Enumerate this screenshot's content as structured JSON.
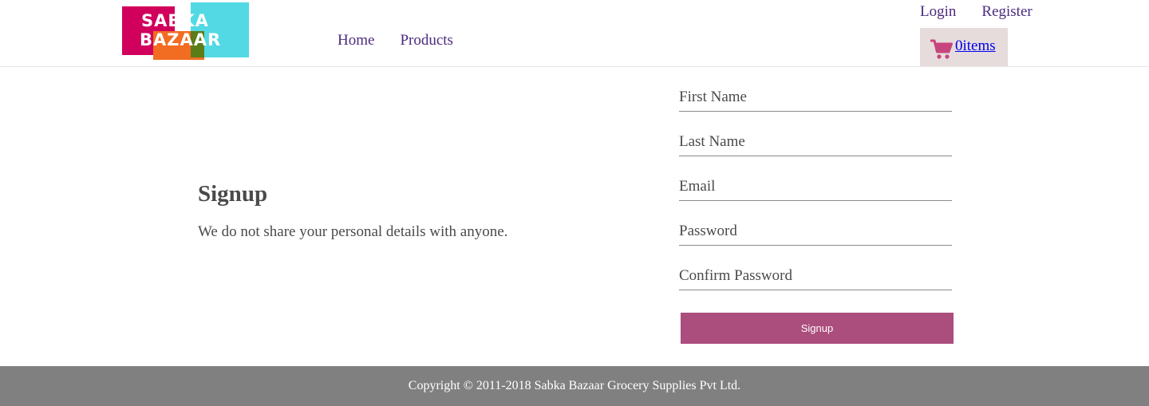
{
  "header": {
    "logo": {
      "line1": "SABKA",
      "line2": "BAZAAR"
    },
    "nav": [
      {
        "label": "Home"
      },
      {
        "label": "Products"
      }
    ],
    "auth": {
      "login": "Login",
      "register": "Register"
    },
    "cart": {
      "icon": "cart-icon",
      "label": "0items",
      "icon_color": "#c7457d",
      "background": "#e6dcdc"
    }
  },
  "main": {
    "title": "Signup",
    "subtitle": "We do not share your personal details with anyone.",
    "form": {
      "fields": [
        {
          "placeholder": "First Name",
          "value": ""
        },
        {
          "placeholder": "Last Name",
          "value": ""
        },
        {
          "placeholder": "Email",
          "value": ""
        },
        {
          "placeholder": "Password",
          "value": ""
        },
        {
          "placeholder": "Confirm Password",
          "value": ""
        }
      ],
      "submit_label": "Signup",
      "submit_color": "#ab4d7d"
    }
  },
  "footer": {
    "copyright": "Copyright © 2011-2018 Sabka Bazaar Grocery Supplies Pvt Ltd.",
    "background": "#808080"
  },
  "colors": {
    "nav_link": "#4b2a7e",
    "text": "#4a4a4a"
  }
}
